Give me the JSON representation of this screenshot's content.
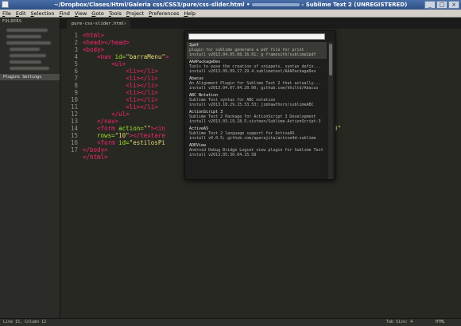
{
  "window": {
    "title_path": "~/Dropbox/Clases/Html/Galeria css/CSS3/pure/css-slider.html",
    "title_sep": "•",
    "title_app": "- Sublime Text 2 (UNREGISTERED)",
    "btn_min": "_",
    "btn_max": "□",
    "btn_close": "×"
  },
  "menu": [
    "File",
    "Edit",
    "Selection",
    "Find",
    "View",
    "Goto",
    "Tools",
    "Project",
    "Preferences",
    "Help"
  ],
  "sidebar": {
    "header": "FOLDERS",
    "selected_item": "Plugins Settings"
  },
  "tab": {
    "label": "pure-css-slider.html",
    "close": "×"
  },
  "editor": {
    "line_numbers": [
      "1",
      "2",
      "3",
      "4",
      "5",
      "6",
      "7",
      "8",
      "9",
      "10",
      "11",
      "12",
      "13",
      "14",
      "15",
      "16",
      "17"
    ],
    "lines": [
      [
        [
          "tag",
          "<html>"
        ]
      ],
      [
        [
          "tag",
          "<head></head>"
        ]
      ],
      [
        [
          "tag",
          "<body>"
        ]
      ],
      [
        [
          "pun",
          "    "
        ],
        [
          "tag",
          "<nav "
        ],
        [
          "att",
          "id="
        ],
        [
          "str",
          "\"barraMenu\""
        ],
        [
          "tag",
          ">"
        ]
      ],
      [
        [
          "pun",
          "        "
        ],
        [
          "tag",
          "<ul>"
        ]
      ],
      [
        [
          "pun",
          "            "
        ],
        [
          "tag",
          "<li></li>"
        ]
      ],
      [
        [
          "pun",
          "            "
        ],
        [
          "tag",
          "<li></li>"
        ]
      ],
      [
        [
          "pun",
          "            "
        ],
        [
          "tag",
          "<li></li>"
        ]
      ],
      [
        [
          "pun",
          "            "
        ],
        [
          "tag",
          "<li></li>"
        ]
      ],
      [
        [
          "pun",
          "            "
        ],
        [
          "tag",
          "<li></li>"
        ]
      ],
      [
        [
          "pun",
          "            "
        ],
        [
          "tag",
          "<li></li>"
        ]
      ],
      [
        [
          "pun",
          "        "
        ],
        [
          "tag",
          "</ul>"
        ]
      ],
      [
        [
          "pun",
          "    "
        ],
        [
          "tag",
          "</nav>"
        ]
      ],
      [
        [
          "pun",
          "    "
        ],
        [
          "tag",
          "<form "
        ],
        [
          "att",
          "action="
        ],
        [
          "str",
          "\"\""
        ],
        [
          "tag",
          "><in"
        ],
        [
          "pun",
          "                                  "
        ],
        [
          "att",
          "id="
        ],
        [
          "str",
          "\"\""
        ],
        [
          "pun",
          " "
        ],
        [
          "att",
          "cols="
        ],
        [
          "str",
          "\"30\""
        ]
      ],
      [
        [
          "pun",
          "    "
        ],
        [
          "att",
          "rows="
        ],
        [
          "str",
          "\"10\""
        ],
        [
          "tag",
          "></textare"
        ]
      ],
      [
        [
          "pun",
          "    "
        ],
        [
          "tag",
          "<form "
        ],
        [
          "att",
          "id="
        ],
        [
          "str",
          "\"estilosPi"
        ]
      ],
      [
        [
          "tag",
          "</body>"
        ]
      ],
      [
        [
          "tag",
          "</html>"
        ]
      ]
    ]
  },
  "palette": {
    "input_value": "",
    "entries": [
      {
        "name": "2pdf",
        "desc": "plugin for sublime generate a pdf file for print",
        "install": "install v2013.04.05.08.16.01; g framosith/sublime2pdf"
      },
      {
        "name": "AAAPackageDev",
        "desc": "Tools to ease the creation of snippets, syntax defin...",
        "install": "install v2013.09.09.17.29.4.sublimetext/AAAPackageDev"
      },
      {
        "name": "Abacus",
        "desc": "An Alignment Plugin for Sublime Text 2 that actually...",
        "install": "install v2013.04.07.04.20.00; github.com/khiltd/Abacus"
      },
      {
        "name": "ABC Notation",
        "desc": "Sublime Text syntax for ABC notation",
        "install": "install v2013.10.29.15.53.53; jimhawthorn/sublimeABC"
      },
      {
        "name": "ActionScript 3",
        "desc": "Sublime Text 2 Package for ActionScript 3 Development",
        "install": "install v2013.03.19.18.5.sixteen/Sublime-ActionScript-3"
      },
      {
        "name": "ActiveAS",
        "desc": "Sublime Text 2 language support for ActiveAS",
        "install": "install v0.0.5; github.com/aparajita/active4d-sublime"
      },
      {
        "name": "ADEView",
        "desc": "Android Debug Bridge Logcat view plugin for Sublime Text 2",
        "install": "install v2013.05.30.04.15.58"
      }
    ]
  },
  "status": {
    "position": "Line 15, Column 12",
    "tab_size": "Tab Size: 4",
    "syntax": "HTML"
  },
  "colors": {
    "editor_bg": "#272822",
    "tag": "#f92672",
    "attribute": "#a6e22e",
    "string": "#e6db74"
  }
}
